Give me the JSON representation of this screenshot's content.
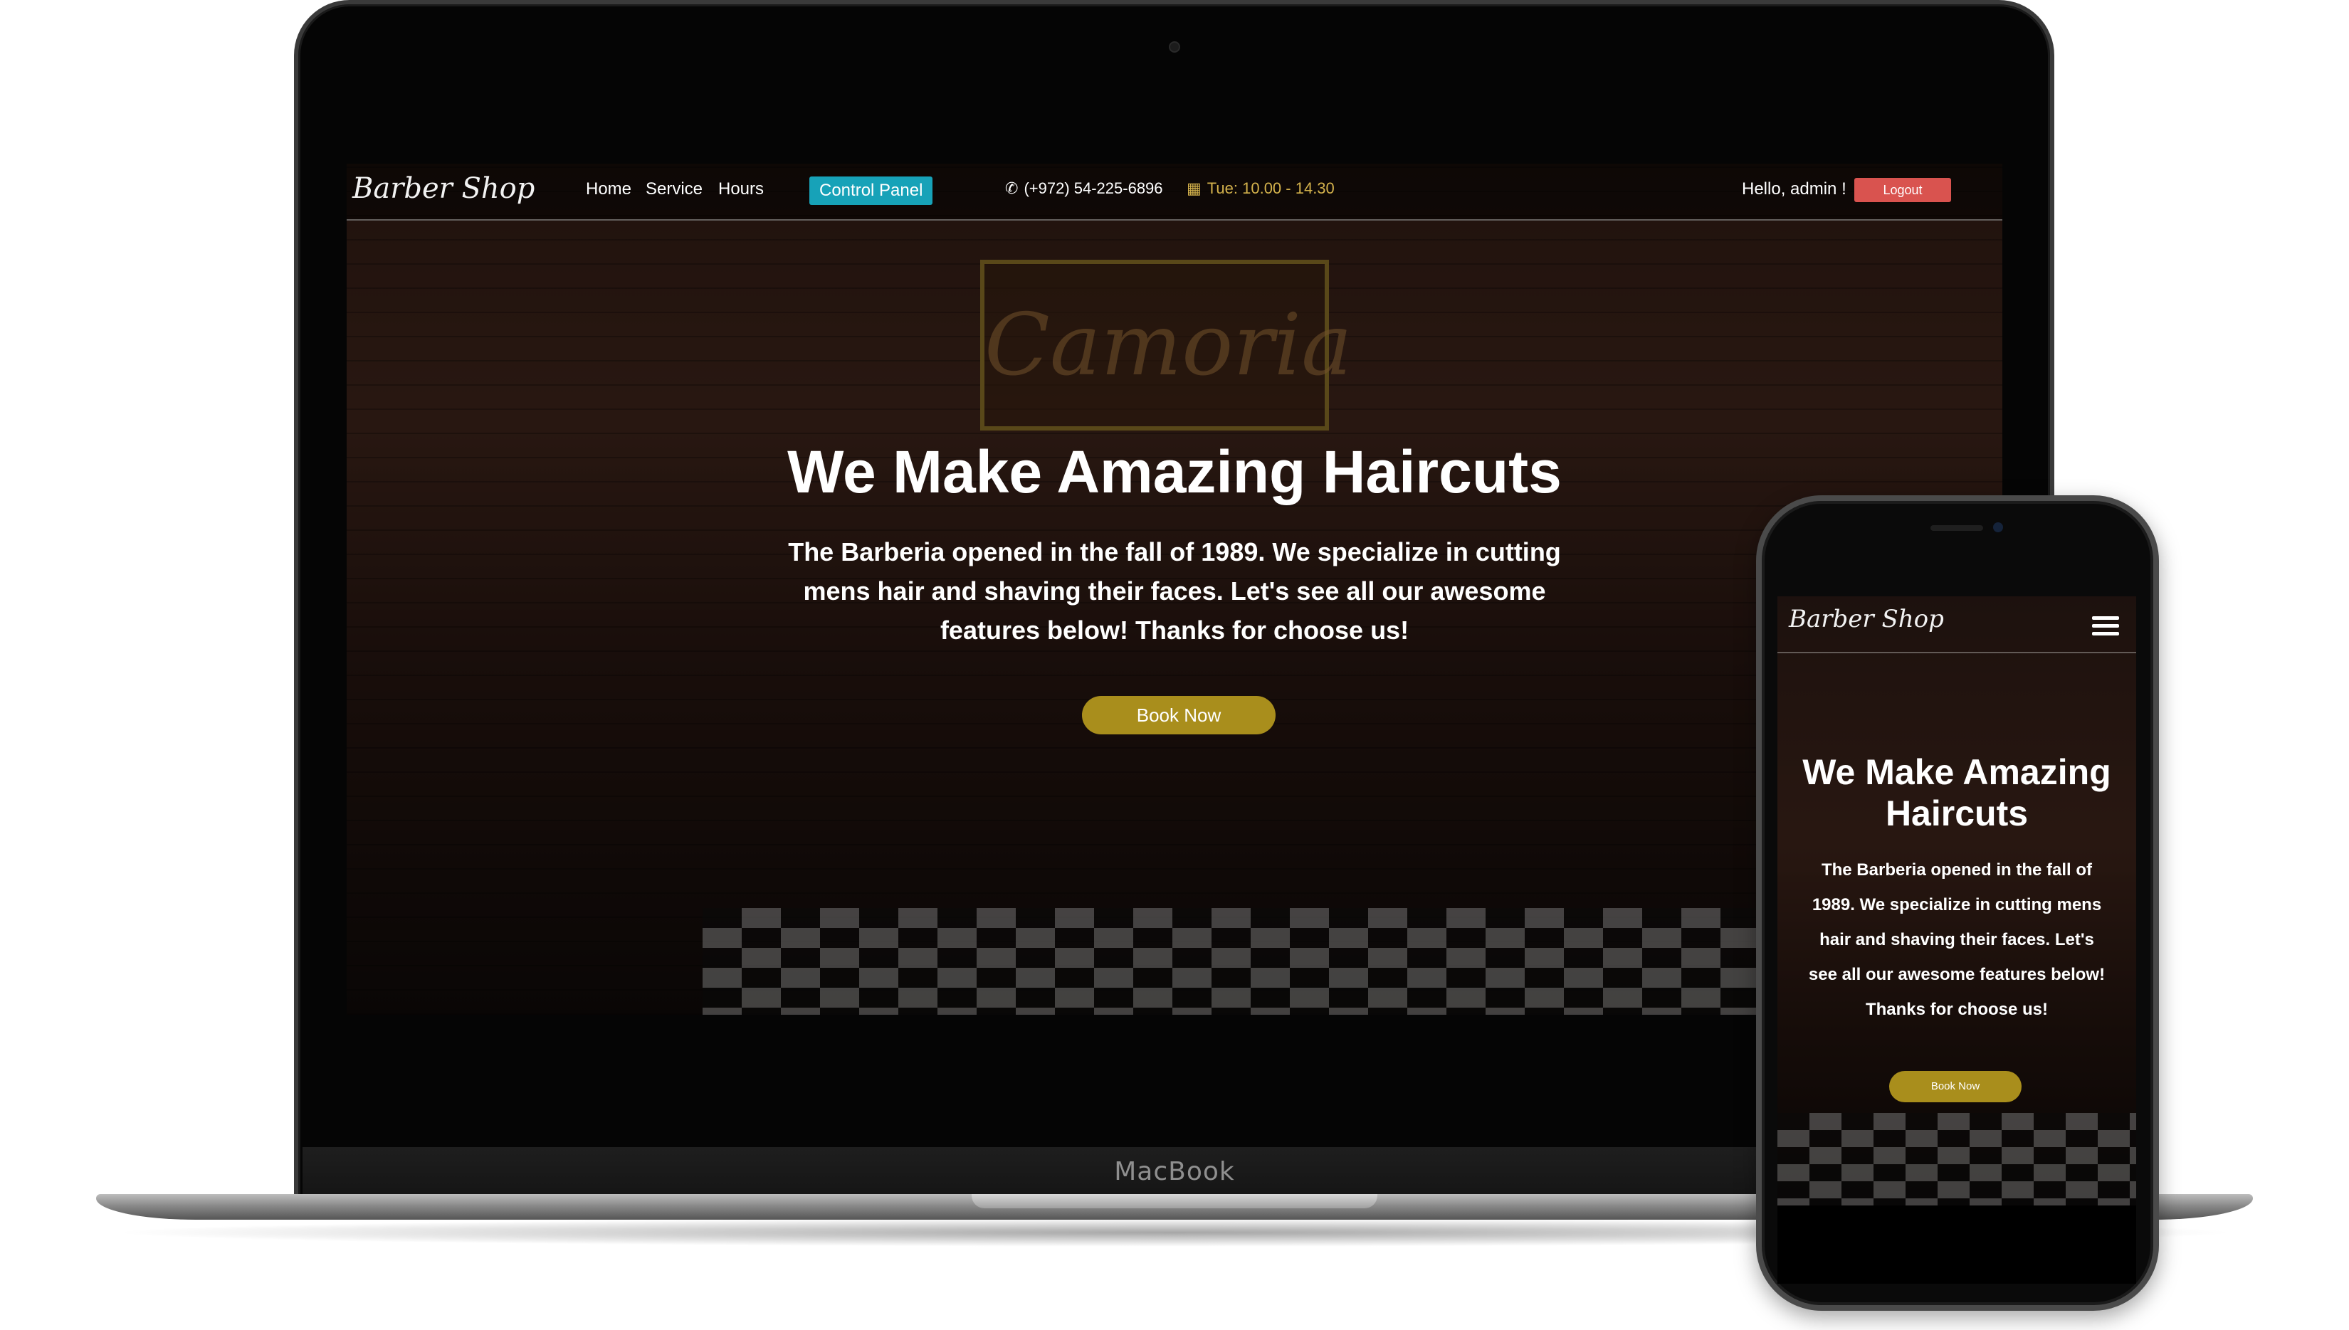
{
  "desktop": {
    "brand": "Barber Shop",
    "nav": [
      "Home",
      "Service",
      "Hours"
    ],
    "control_panel": "Control Panel",
    "phone": "(+972) 54-225-6896",
    "hours": "Tue: 10.00 - 14.30",
    "greeting": "Hello, admin !",
    "logout": "Logout",
    "sign": "Camoria",
    "hero_title": "We Make Amazing Haircuts",
    "hero_text": "The Barberia opened in the fall of 1989. We specialize in cutting mens hair and shaving their faces. Let's see all our awesome features below! Thanks for choose us!",
    "book_button": "Book Now"
  },
  "laptop_label": "MacBook",
  "mobile": {
    "brand": "Barber Shop",
    "hero_title": "We Make Amazing Haircuts",
    "hero_text": "The Barberia opened in the fall of 1989. We specialize in cutting mens hair and shaving their faces. Let's see all our awesome features below! Thanks for choose us!",
    "book_button": "Book Now"
  },
  "icons": {
    "phone": "phone-icon",
    "calendar": "calendar-icon",
    "menu": "hamburger-menu-icon"
  },
  "colors": {
    "accent_gold": "#a98e1c",
    "control_panel": "#17a2b8",
    "logout": "#d9534f",
    "hours_text": "#d4b24c"
  }
}
